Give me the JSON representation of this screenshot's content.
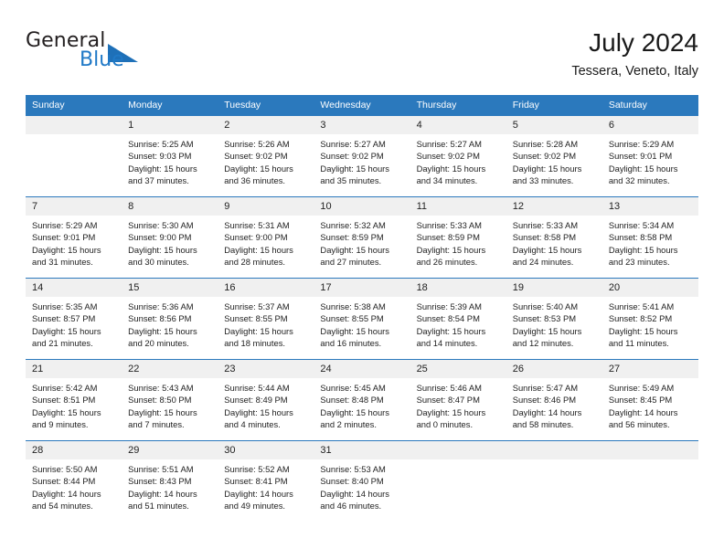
{
  "brand": {
    "name_part1": "General",
    "name_part2": "Blue",
    "accent_color": "#2079c7",
    "triangle_color": "#1e70b8"
  },
  "header": {
    "title": "July 2024",
    "location": "Tessera, Veneto, Italy"
  },
  "calendar": {
    "header_bg": "#2b79bd",
    "daynum_bg": "#f0f0f0",
    "weekday_labels": [
      "Sunday",
      "Monday",
      "Tuesday",
      "Wednesday",
      "Thursday",
      "Friday",
      "Saturday"
    ],
    "weeks": [
      [
        {
          "day": "",
          "lines": []
        },
        {
          "day": "1",
          "lines": [
            "Sunrise: 5:25 AM",
            "Sunset: 9:03 PM",
            "Daylight: 15 hours",
            "and 37 minutes."
          ]
        },
        {
          "day": "2",
          "lines": [
            "Sunrise: 5:26 AM",
            "Sunset: 9:02 PM",
            "Daylight: 15 hours",
            "and 36 minutes."
          ]
        },
        {
          "day": "3",
          "lines": [
            "Sunrise: 5:27 AM",
            "Sunset: 9:02 PM",
            "Daylight: 15 hours",
            "and 35 minutes."
          ]
        },
        {
          "day": "4",
          "lines": [
            "Sunrise: 5:27 AM",
            "Sunset: 9:02 PM",
            "Daylight: 15 hours",
            "and 34 minutes."
          ]
        },
        {
          "day": "5",
          "lines": [
            "Sunrise: 5:28 AM",
            "Sunset: 9:02 PM",
            "Daylight: 15 hours",
            "and 33 minutes."
          ]
        },
        {
          "day": "6",
          "lines": [
            "Sunrise: 5:29 AM",
            "Sunset: 9:01 PM",
            "Daylight: 15 hours",
            "and 32 minutes."
          ]
        }
      ],
      [
        {
          "day": "7",
          "lines": [
            "Sunrise: 5:29 AM",
            "Sunset: 9:01 PM",
            "Daylight: 15 hours",
            "and 31 minutes."
          ]
        },
        {
          "day": "8",
          "lines": [
            "Sunrise: 5:30 AM",
            "Sunset: 9:00 PM",
            "Daylight: 15 hours",
            "and 30 minutes."
          ]
        },
        {
          "day": "9",
          "lines": [
            "Sunrise: 5:31 AM",
            "Sunset: 9:00 PM",
            "Daylight: 15 hours",
            "and 28 minutes."
          ]
        },
        {
          "day": "10",
          "lines": [
            "Sunrise: 5:32 AM",
            "Sunset: 8:59 PM",
            "Daylight: 15 hours",
            "and 27 minutes."
          ]
        },
        {
          "day": "11",
          "lines": [
            "Sunrise: 5:33 AM",
            "Sunset: 8:59 PM",
            "Daylight: 15 hours",
            "and 26 minutes."
          ]
        },
        {
          "day": "12",
          "lines": [
            "Sunrise: 5:33 AM",
            "Sunset: 8:58 PM",
            "Daylight: 15 hours",
            "and 24 minutes."
          ]
        },
        {
          "day": "13",
          "lines": [
            "Sunrise: 5:34 AM",
            "Sunset: 8:58 PM",
            "Daylight: 15 hours",
            "and 23 minutes."
          ]
        }
      ],
      [
        {
          "day": "14",
          "lines": [
            "Sunrise: 5:35 AM",
            "Sunset: 8:57 PM",
            "Daylight: 15 hours",
            "and 21 minutes."
          ]
        },
        {
          "day": "15",
          "lines": [
            "Sunrise: 5:36 AM",
            "Sunset: 8:56 PM",
            "Daylight: 15 hours",
            "and 20 minutes."
          ]
        },
        {
          "day": "16",
          "lines": [
            "Sunrise: 5:37 AM",
            "Sunset: 8:55 PM",
            "Daylight: 15 hours",
            "and 18 minutes."
          ]
        },
        {
          "day": "17",
          "lines": [
            "Sunrise: 5:38 AM",
            "Sunset: 8:55 PM",
            "Daylight: 15 hours",
            "and 16 minutes."
          ]
        },
        {
          "day": "18",
          "lines": [
            "Sunrise: 5:39 AM",
            "Sunset: 8:54 PM",
            "Daylight: 15 hours",
            "and 14 minutes."
          ]
        },
        {
          "day": "19",
          "lines": [
            "Sunrise: 5:40 AM",
            "Sunset: 8:53 PM",
            "Daylight: 15 hours",
            "and 12 minutes."
          ]
        },
        {
          "day": "20",
          "lines": [
            "Sunrise: 5:41 AM",
            "Sunset: 8:52 PM",
            "Daylight: 15 hours",
            "and 11 minutes."
          ]
        }
      ],
      [
        {
          "day": "21",
          "lines": [
            "Sunrise: 5:42 AM",
            "Sunset: 8:51 PM",
            "Daylight: 15 hours",
            "and 9 minutes."
          ]
        },
        {
          "day": "22",
          "lines": [
            "Sunrise: 5:43 AM",
            "Sunset: 8:50 PM",
            "Daylight: 15 hours",
            "and 7 minutes."
          ]
        },
        {
          "day": "23",
          "lines": [
            "Sunrise: 5:44 AM",
            "Sunset: 8:49 PM",
            "Daylight: 15 hours",
            "and 4 minutes."
          ]
        },
        {
          "day": "24",
          "lines": [
            "Sunrise: 5:45 AM",
            "Sunset: 8:48 PM",
            "Daylight: 15 hours",
            "and 2 minutes."
          ]
        },
        {
          "day": "25",
          "lines": [
            "Sunrise: 5:46 AM",
            "Sunset: 8:47 PM",
            "Daylight: 15 hours",
            "and 0 minutes."
          ]
        },
        {
          "day": "26",
          "lines": [
            "Sunrise: 5:47 AM",
            "Sunset: 8:46 PM",
            "Daylight: 14 hours",
            "and 58 minutes."
          ]
        },
        {
          "day": "27",
          "lines": [
            "Sunrise: 5:49 AM",
            "Sunset: 8:45 PM",
            "Daylight: 14 hours",
            "and 56 minutes."
          ]
        }
      ],
      [
        {
          "day": "28",
          "lines": [
            "Sunrise: 5:50 AM",
            "Sunset: 8:44 PM",
            "Daylight: 14 hours",
            "and 54 minutes."
          ]
        },
        {
          "day": "29",
          "lines": [
            "Sunrise: 5:51 AM",
            "Sunset: 8:43 PM",
            "Daylight: 14 hours",
            "and 51 minutes."
          ]
        },
        {
          "day": "30",
          "lines": [
            "Sunrise: 5:52 AM",
            "Sunset: 8:41 PM",
            "Daylight: 14 hours",
            "and 49 minutes."
          ]
        },
        {
          "day": "31",
          "lines": [
            "Sunrise: 5:53 AM",
            "Sunset: 8:40 PM",
            "Daylight: 14 hours",
            "and 46 minutes."
          ]
        },
        {
          "day": "",
          "lines": []
        },
        {
          "day": "",
          "lines": []
        },
        {
          "day": "",
          "lines": []
        }
      ]
    ]
  }
}
